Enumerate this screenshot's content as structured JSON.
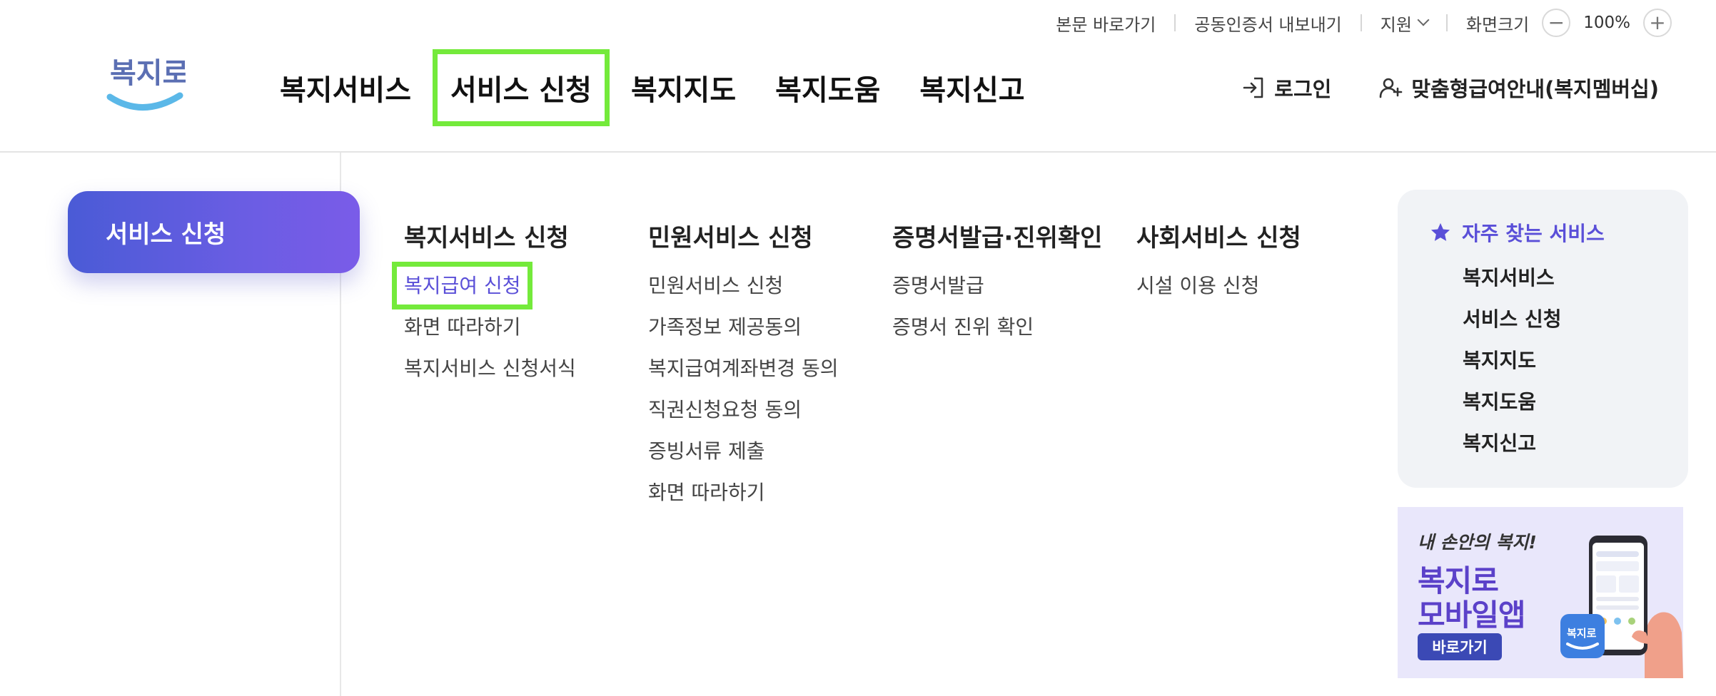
{
  "utility": {
    "skip_to_content": "본문 바로가기",
    "export_certificate": "공동인증서 내보내기",
    "support": "지원",
    "zoom_label": "화면크기",
    "zoom_value": "100%",
    "zoom_out": "−",
    "zoom_in": "+"
  },
  "logo": {
    "text": "복지로",
    "colors": {
      "text": "#5b6fb3",
      "smile": "#5bb8e8"
    }
  },
  "gnb": {
    "items": [
      {
        "label": "복지서비스"
      },
      {
        "label": "서비스 신청",
        "active": true
      },
      {
        "label": "복지지도"
      },
      {
        "label": "복지도움"
      },
      {
        "label": "복지신고"
      }
    ]
  },
  "header_actions": {
    "login": "로그인",
    "membership": "맞춤형급여안내(복지멤버십)"
  },
  "menu": {
    "section_title": "서비스 신청",
    "columns": [
      {
        "title": "복지서비스 신청",
        "items": [
          "복지급여 신청",
          "화면 따라하기",
          "복지서비스 신청서식"
        ]
      },
      {
        "title": "민원서비스 신청",
        "items": [
          "민원서비스 신청",
          "가족정보 제공동의",
          "복지급여계좌변경 동의",
          "직권신청요청 동의",
          "증빙서류 제출",
          "화면 따라하기"
        ]
      },
      {
        "title": "증명서발급·진위확인",
        "items": [
          "증명서발급",
          "증명서 진위 확인"
        ]
      },
      {
        "title": "사회서비스 신청",
        "items": [
          "시설 이용 신청"
        ]
      }
    ]
  },
  "favorites": {
    "title": "자주 찾는 서비스",
    "items": [
      "복지서비스",
      "서비스 신청",
      "복지지도",
      "복지도움",
      "복지신고"
    ]
  },
  "banner": {
    "subtitle": "내 손안의 복지!",
    "title_line1": "복지로",
    "title_line2": "모바일앱",
    "button": "바로가기",
    "app_icon_text": "복지로"
  },
  "colors": {
    "accent": "#5a4fd8",
    "highlight_outline": "#74ea3b",
    "section_gradient_start": "#4a5bd6",
    "section_gradient_end": "#7a5ce8",
    "favorites_bg": "#f1f3f6",
    "banner_bg": "#e9e7fb"
  }
}
